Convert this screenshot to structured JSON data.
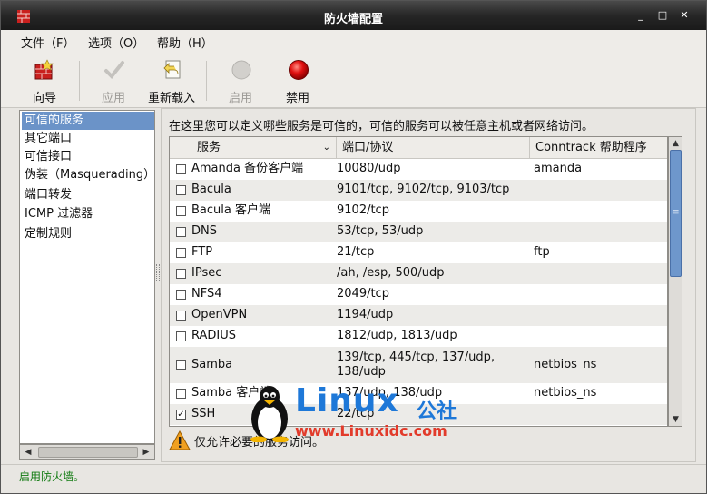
{
  "window": {
    "title": "防火墙配置",
    "controls": {
      "minimize": "_",
      "maximize": "□",
      "close": "✕"
    }
  },
  "menubar": {
    "items": [
      {
        "label": "文件（F）"
      },
      {
        "label": "选项（O）"
      },
      {
        "label": "帮助（H）"
      }
    ]
  },
  "toolbar": {
    "wizard": "向导",
    "apply": "应用",
    "reload": "重新载入",
    "enable": "启用",
    "disable": "禁用"
  },
  "sidebar": {
    "items": [
      {
        "label": "可信的服务",
        "selected": true
      },
      {
        "label": "其它端口"
      },
      {
        "label": "可信接口"
      },
      {
        "label": "伪装（Masquerading）"
      },
      {
        "label": "端口转发"
      },
      {
        "label": "ICMP 过滤器"
      },
      {
        "label": "定制规则"
      }
    ],
    "scroll_left": "◀",
    "scroll_right": "▶"
  },
  "services": {
    "description": "在这里您可以定义哪些服务是可信的，可信的服务可以被任意主机或者网络访问。",
    "columns": {
      "service": "服务",
      "ports": "端口/协议",
      "helper": "Conntrack 帮助程序"
    },
    "sort_indicator": "⌄",
    "rows": [
      {
        "service": "Amanda 备份客户端",
        "ports": "10080/udp",
        "helper": "amanda",
        "checked": false
      },
      {
        "service": "Bacula",
        "ports": "9101/tcp, 9102/tcp, 9103/tcp",
        "helper": "",
        "checked": false
      },
      {
        "service": "Bacula 客户端",
        "ports": "9102/tcp",
        "helper": "",
        "checked": false
      },
      {
        "service": "DNS",
        "ports": "53/tcp, 53/udp",
        "helper": "",
        "checked": false
      },
      {
        "service": "FTP",
        "ports": "21/tcp",
        "helper": "ftp",
        "checked": false
      },
      {
        "service": "IPsec",
        "ports": "/ah, /esp, 500/udp",
        "helper": "",
        "checked": false
      },
      {
        "service": "NFS4",
        "ports": "2049/tcp",
        "helper": "",
        "checked": false
      },
      {
        "service": "OpenVPN",
        "ports": "1194/udp",
        "helper": "",
        "checked": false
      },
      {
        "service": "RADIUS",
        "ports": "1812/udp, 1813/udp",
        "helper": "",
        "checked": false
      },
      {
        "service": "Samba",
        "ports": "139/tcp, 445/tcp, 137/udp, 138/udp",
        "helper": "netbios_ns",
        "checked": false
      },
      {
        "service": "Samba 客户端",
        "ports": "137/udp, 138/udp",
        "helper": "netbios_ns",
        "checked": false
      },
      {
        "service": "SSH",
        "ports": "22/tcp",
        "helper": "",
        "checked": true
      }
    ],
    "check_mark": "✓",
    "scroll_up": "▲",
    "scroll_down": "▼",
    "scroll_grip": "≡"
  },
  "warning": {
    "text": "仅允许必要的服务访问。"
  },
  "statusbar": {
    "text": "启用防火墙。"
  },
  "watermark": {
    "brand": "Linux",
    "brand_cn": "公社",
    "url": "www.Linuxidc.com"
  },
  "colors": {
    "selection": "#6b93c8",
    "status_text": "#0f7a0f",
    "disable_red": "#e01010",
    "warning_orange": "#f0a020"
  }
}
